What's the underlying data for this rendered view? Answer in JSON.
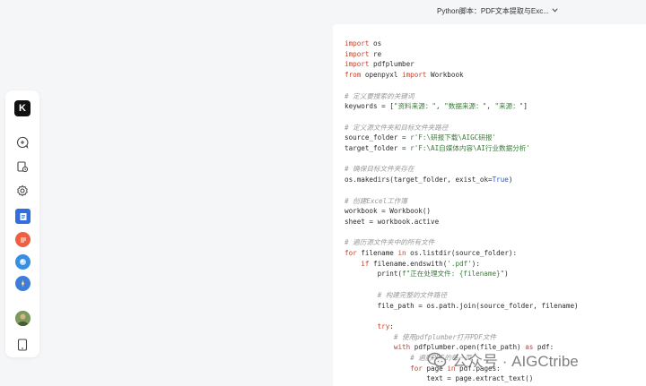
{
  "header": {
    "doc_title": "Python脚本：PDF文本提取与Exc...",
    "dropdown_icon": "chevron-down-icon"
  },
  "sidebar": {
    "logo_text": "K",
    "items": [
      {
        "name": "new-chat-icon"
      },
      {
        "name": "history-icon"
      },
      {
        "name": "settings-gear-icon"
      },
      {
        "name": "docs-app-icon",
        "color": "#2f6fe0"
      },
      {
        "name": "notes-app-icon",
        "color": "#f06040"
      },
      {
        "name": "browser-app-icon",
        "color": "#3a8ee0"
      },
      {
        "name": "compass-app-icon",
        "color": "#3d7fd8"
      },
      {
        "name": "user-avatar"
      },
      {
        "name": "tablet-icon"
      }
    ]
  },
  "code": {
    "lines": [
      "import os",
      "import re",
      "import pdfplumber",
      "from openpyxl import Workbook",
      "",
      "# 定义要搜索的关键词",
      "keywords = [\"资料来源：\", \"数据来源：\", \"来源：\"]",
      "",
      "# 定义源文件夹和目标文件夹路径",
      "source_folder = r'F:\\研报下载\\AIGC研报'",
      "target_folder = r'F:\\AI自媒体内容\\AI行业数据分析'",
      "",
      "# 确保目标文件夹存在",
      "os.makedirs(target_folder, exist_ok=True)",
      "",
      "# 创建Excel工作簿",
      "workbook = Workbook()",
      "sheet = workbook.active",
      "",
      "# 遍历源文件夹中的所有文件",
      "for filename in os.listdir(source_folder):",
      "    if filename.endswith('.pdf'):",
      "        print(f\"正在处理文件: {filename}\")",
      "",
      "        # 构建完整的文件路径",
      "        file_path = os.path.join(source_folder, filename)",
      "",
      "        try:",
      "            # 使用pdfplumber打开PDF文件",
      "            with pdfplumber.open(file_path) as pdf:",
      "                # 遍历PDF的每一页",
      "                for page in pdf.pages:",
      "                    text = page.extract_text()"
    ]
  },
  "watermark": {
    "text": "公众号 · AIGCtribe",
    "icon": "wechat-icon"
  }
}
